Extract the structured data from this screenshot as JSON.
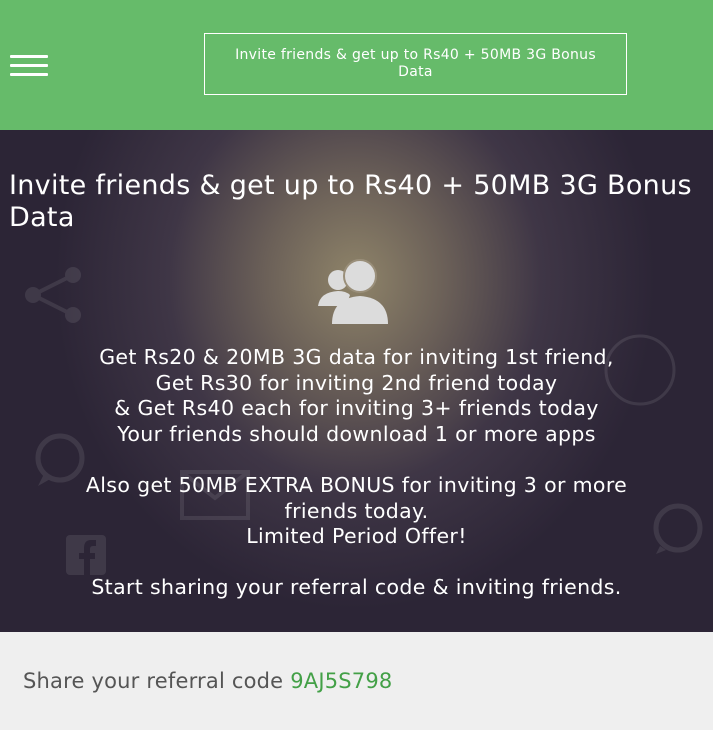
{
  "header": {
    "title_box": "Invite friends & get up to Rs40 + 50MB 3G Bonus Data"
  },
  "hero": {
    "heading": "Invite friends & get up to Rs40 + 50MB 3G Bonus Data",
    "lines": [
      "Get Rs20 & 20MB 3G data for inviting 1st friend,",
      "Get Rs30 for inviting 2nd friend today",
      "& Get Rs40 each for inviting 3+ friends today",
      "Your friends should download 1 or more apps",
      "",
      "Also get 50MB EXTRA BONUS for inviting 3 or more",
      "friends today.",
      "Limited Period Offer!",
      "",
      "Start sharing your referral code & inviting friends."
    ]
  },
  "share": {
    "label": "Share your referral code",
    "code": "9AJ5S798"
  },
  "colors": {
    "topbar": "#66bb6a",
    "code": "#43a047"
  }
}
